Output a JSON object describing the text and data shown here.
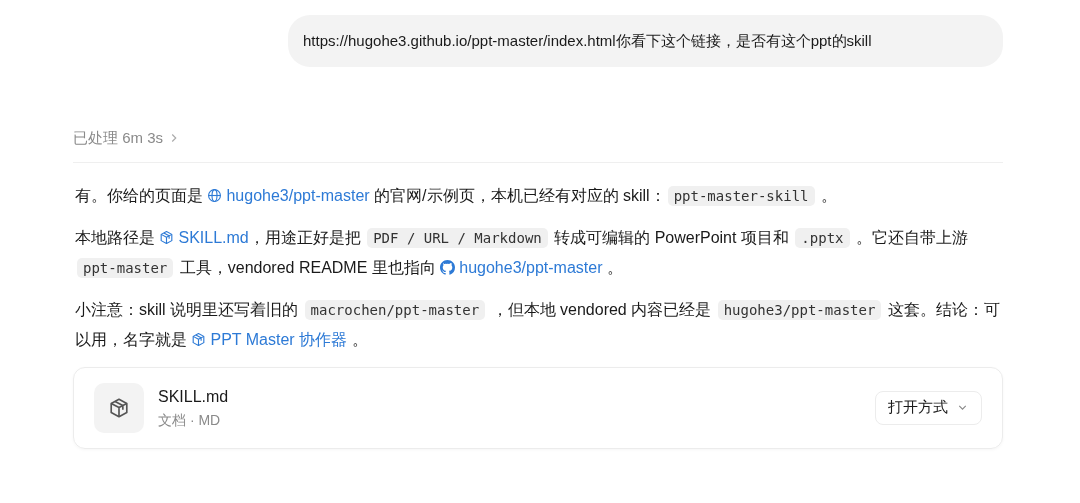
{
  "user_message": {
    "text": "https://hugohe3.github.io/ppt-master/index.html你看下这个链接，是否有这个ppt的skill"
  },
  "processed": {
    "label": "已处理 6m 3s"
  },
  "paragraphs": [
    {
      "segments": [
        {
          "kind": "text",
          "text": "有。你给的页面是 "
        },
        {
          "kind": "web_link",
          "text": "hugohe3/ppt-master"
        },
        {
          "kind": "text",
          "text": " 的官网/示例页，本机已经有对应的 skill："
        },
        {
          "kind": "code",
          "text": "ppt-master-skill"
        },
        {
          "kind": "text",
          "text": " 。"
        }
      ]
    },
    {
      "segments": [
        {
          "kind": "text",
          "text": "本地路径是 "
        },
        {
          "kind": "skill_link",
          "text": "SKILL.md"
        },
        {
          "kind": "text",
          "text": "，用途正好是把 "
        },
        {
          "kind": "code",
          "text": "PDF / URL / Markdown"
        },
        {
          "kind": "text",
          "text": " 转成可编辑的 PowerPoint 项目和 "
        },
        {
          "kind": "code",
          "text": ".pptx"
        },
        {
          "kind": "text",
          "text": " 。它还自带上游 "
        },
        {
          "kind": "code",
          "text": "ppt-master"
        },
        {
          "kind": "text",
          "text": " 工具，vendored README 里也指向 "
        },
        {
          "kind": "repo_link",
          "text": "hugohe3/ppt-master"
        },
        {
          "kind": "text",
          "text": " 。"
        }
      ]
    },
    {
      "segments": [
        {
          "kind": "text",
          "text": "小注意：skill 说明里还写着旧的 "
        },
        {
          "kind": "code",
          "text": "macrochen/ppt-master"
        },
        {
          "kind": "text",
          "text": " ，但本地 vendored 内容已经是 "
        },
        {
          "kind": "code",
          "text": "hugohe3/ppt-master"
        },
        {
          "kind": "text",
          "text": " 这套。结论：可以用，名字就是 "
        },
        {
          "kind": "skill_link",
          "text": "PPT Master 协作器"
        },
        {
          "kind": "text",
          "text": " 。"
        }
      ]
    }
  ],
  "file_card": {
    "name": "SKILL.md",
    "meta": "文档 · MD",
    "open_button": "打开方式"
  }
}
